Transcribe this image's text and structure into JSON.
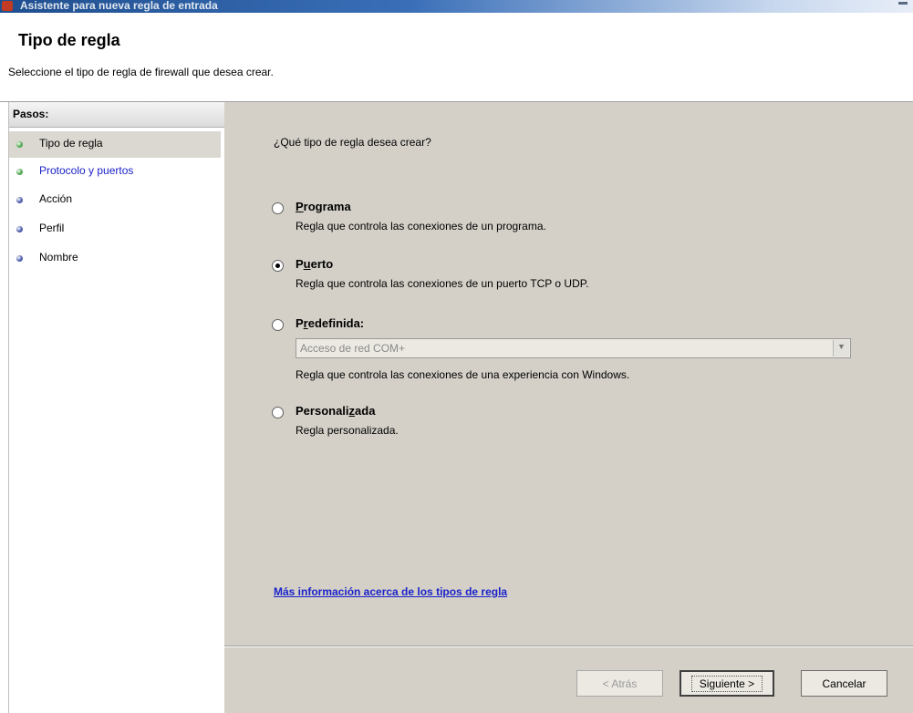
{
  "window": {
    "title": "Asistente para nueva regla de entrada"
  },
  "header": {
    "title": "Tipo de regla",
    "subtitle": "Seleccione el tipo de regla de firewall que desea crear."
  },
  "sidebar": {
    "header": "Pasos:",
    "steps": [
      {
        "label": "Tipo de regla",
        "state": "current",
        "dot_color": "#4ca64c"
      },
      {
        "label": "Protocolo y puertos",
        "state": "link",
        "dot_color": "#4ca64c"
      },
      {
        "label": "Acción",
        "state": "pending",
        "dot_color": "#4a5aa8"
      },
      {
        "label": "Perfil",
        "state": "pending",
        "dot_color": "#4a5aa8"
      },
      {
        "label": "Nombre",
        "state": "pending",
        "dot_color": "#4a5aa8"
      }
    ]
  },
  "main": {
    "question": "¿Qué tipo de regla desea crear?",
    "options": [
      {
        "title_pre": "",
        "title_key": "P",
        "title_post": "rograma",
        "description": "Regla que controla las conexiones de un programa.",
        "selected": false
      },
      {
        "title_pre": "P",
        "title_key": "u",
        "title_post": "erto",
        "description": "Regla que controla las conexiones de un puerto TCP o UDP.",
        "selected": true
      },
      {
        "title_pre": "P",
        "title_key": "r",
        "title_post": "edefinida:",
        "description": "Regla que controla las conexiones de una experiencia con Windows.",
        "selected": false
      },
      {
        "title_pre": "Personali",
        "title_key": "z",
        "title_post": "ada",
        "description": "Regla personalizada.",
        "selected": false
      }
    ],
    "predefined_select": {
      "value": "Acceso de red COM+",
      "enabled": false
    },
    "more_info_link": "Más información acerca de los tipos de regla"
  },
  "footer": {
    "back_label": "< Atrás",
    "next_label": "Siguiente >",
    "cancel_label": "Cancelar"
  },
  "colors": {
    "content_bg": "#d4d0c8",
    "link": "#1a22c8",
    "active_step_bg": "#dad8d0"
  }
}
